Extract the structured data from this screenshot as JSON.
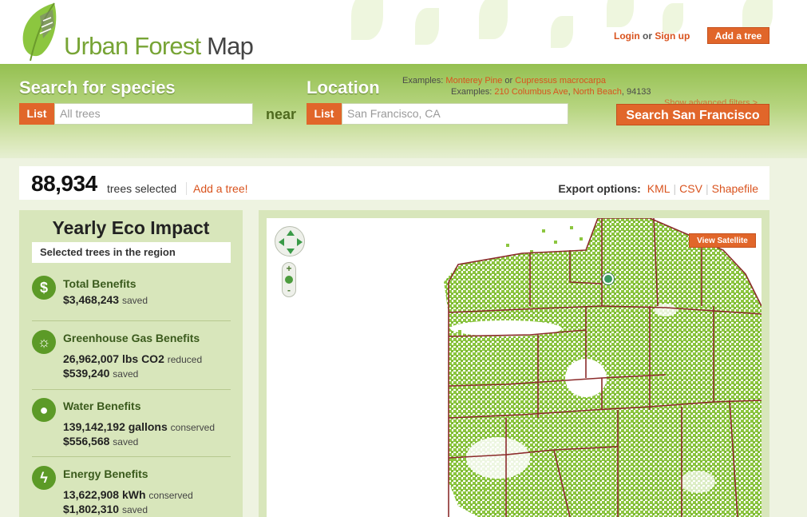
{
  "header": {
    "logo_text_1": "Urban Forest ",
    "logo_text_2": "Map",
    "login": "Login",
    "or": " or ",
    "signup": "Sign up",
    "add_tree_button": "Add a tree"
  },
  "search": {
    "species_title": "Search for species",
    "species_list_button": "List",
    "species_placeholder": "All trees",
    "near": "near",
    "location_title": "Location",
    "location_list_button": "List",
    "location_placeholder": "San Francisco, CA",
    "examples_label": "Examples:",
    "example_species_1": "Monterey Pine",
    "example_or": " or ",
    "example_species_2": "Cupressus macrocarpa",
    "example_location_1": "210 Columbus Ave",
    "example_comma": ", ",
    "example_location_2": "North Beach",
    "example_location_3": ", 94133",
    "advanced_filters": "Show advanced filters >",
    "search_button": "Search San Francisco"
  },
  "stats": {
    "count": "88,934",
    "count_label": "trees selected",
    "add_tree_link": "Add a tree!",
    "export_label": "Export options:",
    "export_options": [
      "KML",
      "CSV",
      "Shapefile"
    ]
  },
  "eco": {
    "title": "Yearly Eco Impact",
    "subtitle": "Selected trees in the region",
    "items": [
      {
        "icon": "dollar-icon",
        "name": "Total Benefits",
        "lines": [
          {
            "value": "$3,468,243",
            "unit": "saved"
          }
        ]
      },
      {
        "icon": "gear-icon",
        "name": "Greenhouse Gas Benefits",
        "lines": [
          {
            "value": "26,962,007 lbs CO2",
            "unit": "reduced"
          },
          {
            "value": "$539,240",
            "unit": "saved"
          }
        ]
      },
      {
        "icon": "water-drop-icon",
        "name": "Water Benefits",
        "lines": [
          {
            "value": "139,142,192 gallons",
            "unit": "conserved"
          },
          {
            "value": "$556,568",
            "unit": "saved"
          }
        ]
      },
      {
        "icon": "lightning-icon",
        "name": "Energy Benefits",
        "lines": [
          {
            "value": "13,622,908 kWh",
            "unit": "conserved"
          },
          {
            "value": "$1,802,310",
            "unit": "saved"
          }
        ]
      }
    ]
  },
  "map": {
    "view_satellite": "View Satellite",
    "zoom_plus": "+",
    "zoom_minus": "-",
    "tree_color": "#8cc63f",
    "boundary_color": "#8b2b2b"
  }
}
